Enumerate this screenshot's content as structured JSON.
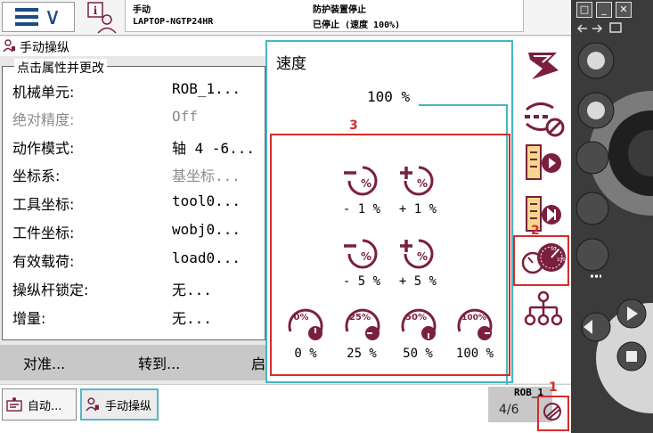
{
  "topbar": {
    "mode": "手动",
    "controller": "LAPTOP-NGTP24HR",
    "guard_status": "防护装置停止",
    "run_status": "已停止 (速度 100%)"
  },
  "jog": {
    "title": "手动操纵",
    "group_title": "点击属性并更改",
    "properties": [
      {
        "label": "机械单元:",
        "value": "ROB_1...",
        "disabled": false
      },
      {
        "label": "绝对精度:",
        "value": "Off",
        "disabled": true
      },
      {
        "label": "动作模式:",
        "value": "轴 4 -6...",
        "disabled": false
      },
      {
        "label": "坐标系:",
        "value": "基坐标...",
        "disabled": true
      },
      {
        "label": "工具坐标:",
        "value": "tool0...",
        "disabled": false
      },
      {
        "label": "工件坐标:",
        "value": "wobj0...",
        "disabled": false
      },
      {
        "label": "有效载荷:",
        "value": "load0...",
        "disabled": false
      },
      {
        "label": "操纵杆锁定:",
        "value": "无...",
        "disabled": false
      },
      {
        "label": "增量:",
        "value": "无...",
        "disabled": false
      }
    ],
    "actions": {
      "align": "对准...",
      "goto": "转到...",
      "start": "启"
    }
  },
  "speed": {
    "title": "速度",
    "current": "100 %",
    "buttons": [
      {
        "label": "- 1 %",
        "icon": "minus-percent-icon"
      },
      {
        "label": "+ 1 %",
        "icon": "plus-percent-icon"
      },
      {
        "label": "- 5 %",
        "icon": "minus-percent-icon"
      },
      {
        "label": "+ 5 %",
        "icon": "plus-percent-icon"
      },
      {
        "label": "0 %",
        "icon": "speed-0-icon"
      },
      {
        "label": "25 %",
        "icon": "speed-25-icon"
      },
      {
        "label": "50 %",
        "icon": "speed-50-icon"
      },
      {
        "label": "100 %",
        "icon": "speed-100-icon"
      }
    ],
    "dial_marks": {
      "zero": "0%",
      "twenty_five": "25%",
      "fifty": "50%",
      "hundred": "100%"
    }
  },
  "annotations": {
    "one": "1",
    "two": "2",
    "three": "3"
  },
  "taskbar": {
    "auto_label": "自动...",
    "jog_label": "手动操纵",
    "robot": "ROB_1",
    "fraction": "4/6"
  },
  "colors": {
    "accent": "#45b5c5",
    "brand": "#7a1f3d",
    "annotation": "#d82b2b"
  }
}
